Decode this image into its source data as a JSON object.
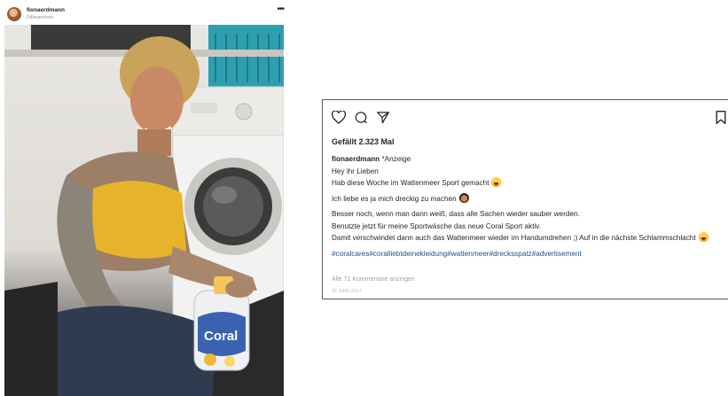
{
  "post": {
    "username": "fionaerdmann",
    "location": "Dillmanchen",
    "more_icon": "more-horizontal-icon",
    "photo": {
      "product_label": "Coral"
    }
  },
  "caption_card": {
    "icons": [
      "heart-icon",
      "comment-icon",
      "share-icon",
      "bookmark-icon"
    ],
    "likes": "Gefällt 2.323 Mal",
    "author": "fionaerdmann",
    "tag": "*Anzeige",
    "lines": [
      "Hey ihr Lieben",
      "Hab diese Woche im Wattenmeer Sport gemacht",
      "Ich liebe es ja mich dreckig zu machen",
      "Besser noch, wenn man dann weiß, dass alle Sachen wieder sauber werden.",
      "Benutzte jetzt für meine Sportwäsche das neue Coral Sport aktiv.",
      "Damit verschwindet dann auch das Wattenmeer wieder im Handumdrehen ;) Auf in die nächste Schlammschlacht"
    ],
    "hashtags": "#coralcares#coralliebtdeinekleidung#wattenmeer#drecksspatz#advertisement",
    "comments_link": "Alle 71 Kommentare anzeigen",
    "date": "25 JUNI 2017"
  }
}
